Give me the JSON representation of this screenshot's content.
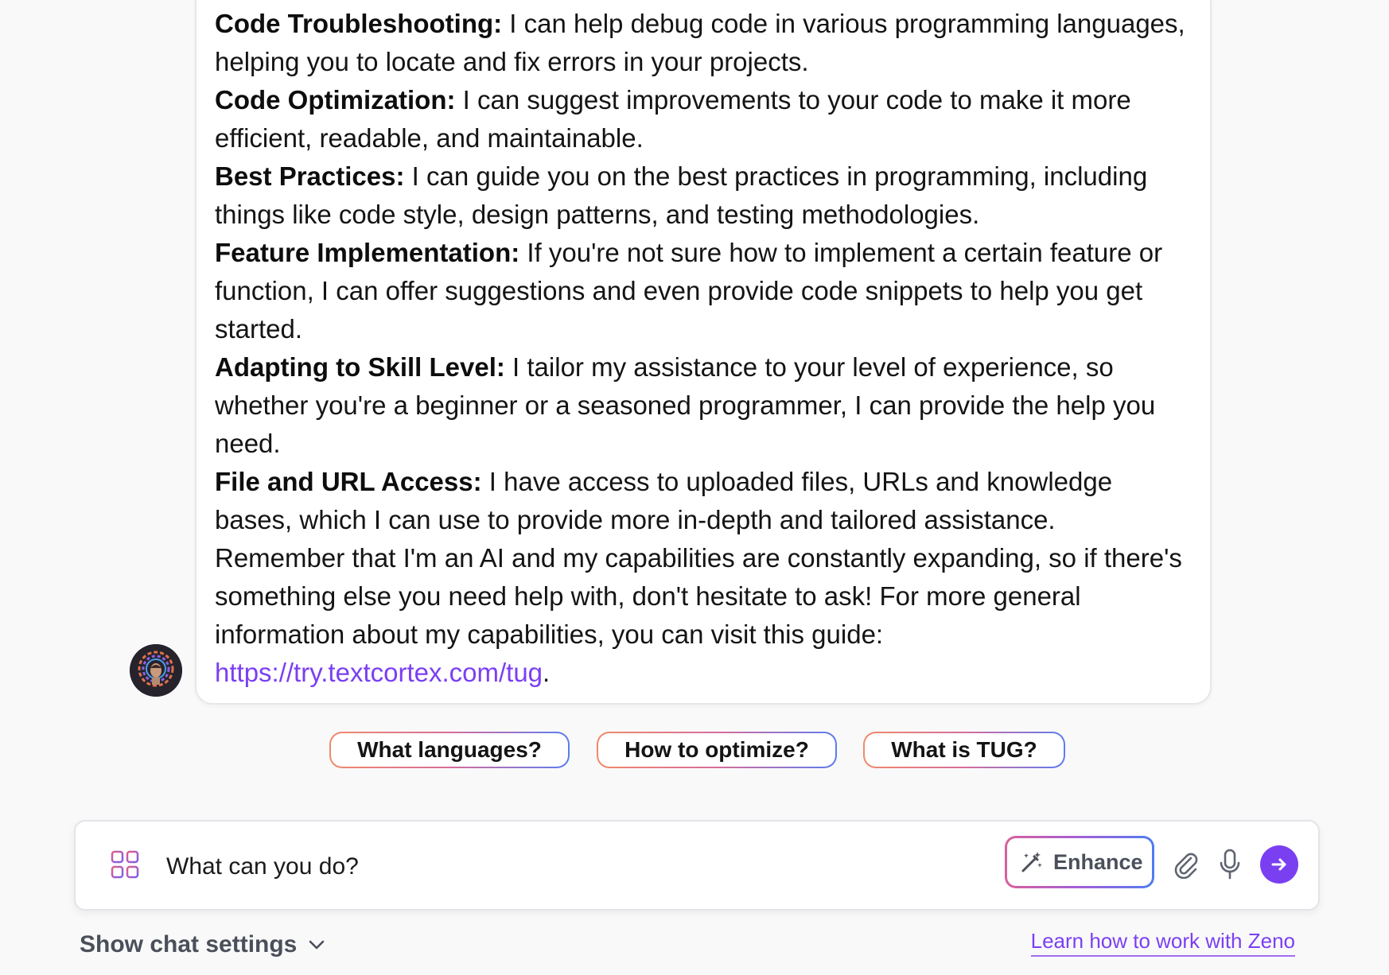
{
  "message": {
    "items": [
      {
        "title": "Code Troubleshooting:",
        "text": " I can help debug code in various programming languages, helping you to locate and fix errors in your projects."
      },
      {
        "title": "Code Optimization:",
        "text": " I can suggest improvements to your code to make it more efficient, readable, and maintainable."
      },
      {
        "title": "Best Practices:",
        "text": " I can guide you on the best practices in programming, including things like code style, design patterns, and testing methodologies."
      },
      {
        "title": "Feature Implementation:",
        "text": " If you're not sure how to implement a certain feature or function, I can offer suggestions and even provide code snippets to help you get started."
      },
      {
        "title": "Adapting to Skill Level:",
        "text": " I tailor my assistance to your level of experience, so whether you're a beginner or a seasoned programmer, I can provide the help you need."
      },
      {
        "title": "File and URL Access:",
        "text": " I have access to uploaded files, URLs and knowledge bases, which I can use to provide more in-depth and tailored assistance."
      }
    ],
    "closing": "Remember that I'm an AI and my capabilities are constantly expanding, so if there's something else you need help with, don't hesitate to ask! For more general information about my capabilities, you can visit this guide: ",
    "link_text": "https://try.textcortex.com/tug",
    "link_suffix": "."
  },
  "suggestions": [
    "What languages?",
    "How to optimize?",
    "What is TUG?"
  ],
  "composer": {
    "input_value": "What can you do?",
    "enhance_label": "Enhance"
  },
  "footer": {
    "settings_label": "Show chat settings",
    "learn_link": "Learn how to work with Zeno"
  },
  "colors": {
    "accent": "#7b3ff2",
    "background": "#f9f9fa",
    "card": "#ffffff"
  }
}
